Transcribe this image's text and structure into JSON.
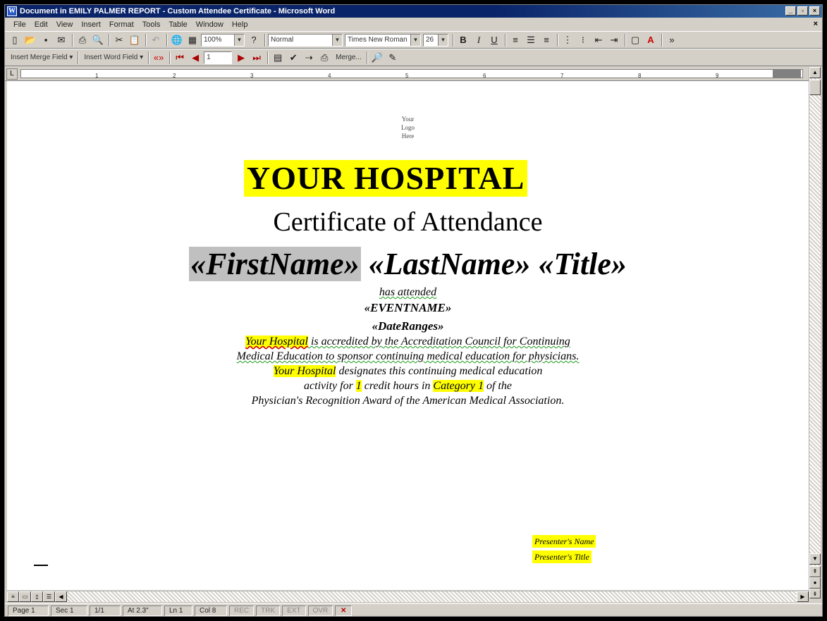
{
  "window": {
    "title": "Document in EMILY PALMER REPORT - Custom Attendee Certificate - Microsoft Word",
    "app_icon": "W",
    "buttons": [
      "_",
      "▫",
      "×"
    ]
  },
  "menubar": {
    "items": [
      "File",
      "Edit",
      "View",
      "Insert",
      "Format",
      "Tools",
      "Table",
      "Window",
      "Help"
    ],
    "close_doc": "×"
  },
  "toolbar1": {
    "zoom": "100%",
    "style": "Normal",
    "font": "Times New Roman",
    "font_size": "26"
  },
  "toolbar2": {
    "insert_merge_field": "Insert Merge Field ▾",
    "insert_word_field": "Insert Word Field ▾",
    "record_number": "1",
    "merge_label": "Merge..."
  },
  "ruler": {
    "ticks": [
      "1",
      "2",
      "3",
      "4",
      "5",
      "6",
      "7",
      "8",
      "9"
    ]
  },
  "document": {
    "logo_lines": [
      "Your",
      "Logo",
      "Here"
    ],
    "hospital": "YOUR HOSPITAL",
    "certificate_title": "Certificate of Attendance",
    "merge_first": "«FirstName»",
    "merge_last": "«LastName»",
    "merge_title": "«Title»",
    "has_attended": "has attended",
    "event_name": "«EVENTNAME»",
    "date_ranges": "«DateRanges»",
    "accreditation": {
      "hospital_hl": "Your Hospital",
      "line1_rest": " is accredited by the Accreditation Council for Continuing",
      "line2": "Medical Education to sponsor continuing medical education for physicians.",
      "line3_hl": "Your Hospital",
      "line3_rest": " designates this continuing medical education",
      "line4_pre": "activity for ",
      "line4_credits": "1",
      "line4_mid": " credit hours in ",
      "line4_category": "Category 1",
      "line4_post": " of the",
      "line5": "Physician's Recognition Award of the American Medical Association."
    },
    "signature": {
      "name": "Presenter's Name",
      "title": "Presenter's Title"
    }
  },
  "statusbar": {
    "page": "Page 1",
    "section": "Sec 1",
    "page_of": "1/1",
    "at": "At 2.3\"",
    "line": "Ln 1",
    "col": "Col 8",
    "rec": "REC",
    "trk": "TRK",
    "ext": "EXT",
    "ovr": "OVR"
  }
}
